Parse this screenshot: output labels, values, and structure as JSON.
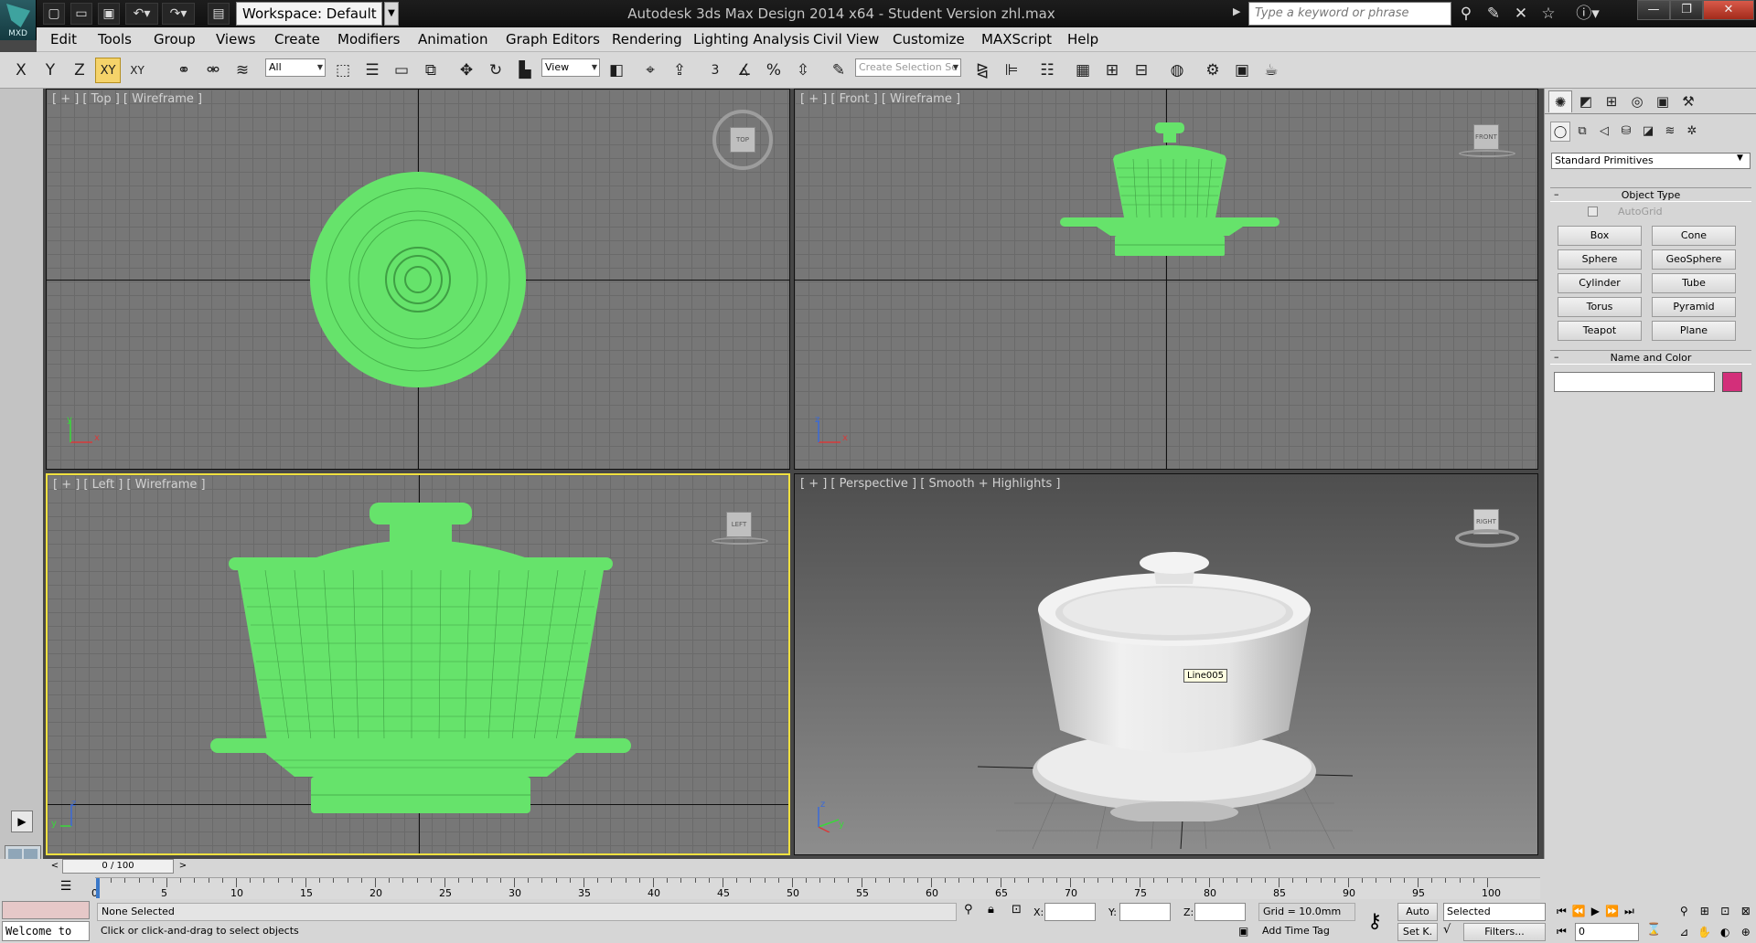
{
  "titlebar": {
    "logo_text": "MXD",
    "workspace": "Workspace: Default",
    "app_title": "Autodesk 3ds Max Design 2014 x64    - Student Version     zhl.max",
    "search_placeholder": "Type a keyword or phrase"
  },
  "menu": [
    "Edit",
    "Tools",
    "Group",
    "Views",
    "Create",
    "Modifiers",
    "Animation",
    "Graph Editors",
    "Rendering",
    "Lighting Analysis",
    "Civil View",
    "Customize",
    "MAXScript",
    "Help"
  ],
  "toolbar": {
    "axis_x": "X",
    "axis_y": "Y",
    "axis_z": "Z",
    "axis_xy": "XY",
    "axis_xy_alt": "XY",
    "selection_filter": "All",
    "reference_coord": "View",
    "named_selection_placeholder": "Create Selection Se",
    "snap_label": "3"
  },
  "viewports": {
    "top": {
      "label": "[ + ] [ Top ] [ Wireframe ]",
      "cube": "TOP"
    },
    "front": {
      "label": "[ + ] [ Front ] [ Wireframe ]",
      "cube": "FRONT"
    },
    "left": {
      "label": "[ + ] [ Left ] [ Wireframe ]",
      "cube": "LEFT"
    },
    "perspective": {
      "label": "[ + ] [ Perspective ] [ Smooth + Highlights ]",
      "cube": "RIGHT",
      "tooltip": "Line005"
    }
  },
  "gizmo": {
    "x": "x",
    "y": "y",
    "z": "z"
  },
  "command_panel": {
    "dropdown": "Standard Primitives",
    "object_type_title": "Object Type",
    "autogrid": "AutoGrid",
    "buttons": [
      "Box",
      "Cone",
      "Sphere",
      "GeoSphere",
      "Cylinder",
      "Tube",
      "Torus",
      "Pyramid",
      "Teapot",
      "Plane"
    ],
    "name_color_title": "Name and Color",
    "name_value": "",
    "color": "#d32f7a"
  },
  "timeline": {
    "slider": "0 / 100",
    "ticks": [
      "0",
      "5",
      "10",
      "15",
      "20",
      "25",
      "30",
      "35",
      "40",
      "45",
      "50",
      "55",
      "60",
      "65",
      "70",
      "75",
      "80",
      "85",
      "90",
      "95",
      "100"
    ]
  },
  "status": {
    "selection": "None Selected",
    "prompt": "Click or click-and-drag to select objects",
    "x_label": "X:",
    "y_label": "Y:",
    "z_label": "Z:",
    "grid": "Grid = 10.0mm",
    "add_time_tag": "Add Time Tag",
    "auto": "Auto",
    "set_key": "Set K.",
    "key_mode": "Selected",
    "filters": "Filters...",
    "frame": "0",
    "maxscript": "Welcome to"
  }
}
